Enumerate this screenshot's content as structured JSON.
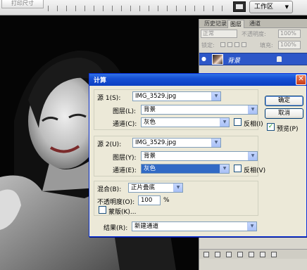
{
  "app": {
    "print_size_label": "打印尺寸",
    "workspace_label": "工作区",
    "workspace_caret": "▼"
  },
  "layers_panel": {
    "tabs": [
      "历史记录",
      "图层",
      "通道"
    ],
    "blend_mode": "正常",
    "opacity_label": "不透明度:",
    "opacity_value": "100%",
    "lock_label": "锁定:",
    "fill_label": "填充:",
    "fill_value": "100%",
    "layer_name": "背景",
    "eye_glyph": "●"
  },
  "dialog": {
    "title": "计算",
    "close_glyph": "✕",
    "source1": {
      "label": "源 1(S):",
      "file": "IMG_3529.jpg",
      "layer_label": "图层(L):",
      "layer_value": "背景",
      "channel_label": "通道(C):",
      "channel_value": "灰色",
      "invert_label": "反相(I)",
      "invert_checked": false
    },
    "source2": {
      "label": "源 2(U):",
      "file": "IMG_3529.jpg",
      "layer_label": "图层(Y):",
      "layer_value": "背景",
      "channel_label": "通道(E):",
      "channel_value": "灰色",
      "invert_label": "反相(V)",
      "invert_checked": false
    },
    "blending": {
      "label": "混合(B):",
      "value": "正片叠底",
      "opacity_label": "不透明度(O):",
      "opacity_value": "100",
      "percent": "%",
      "mask_label": "蒙版(K)..."
    },
    "result": {
      "label": "结果(R):",
      "value": "新建通道"
    },
    "buttons": {
      "ok": "确定",
      "cancel": "取消",
      "preview_label": "预览(P)",
      "preview_checked": true,
      "check_glyph": "✓"
    },
    "arrow_glyph": "▼"
  }
}
